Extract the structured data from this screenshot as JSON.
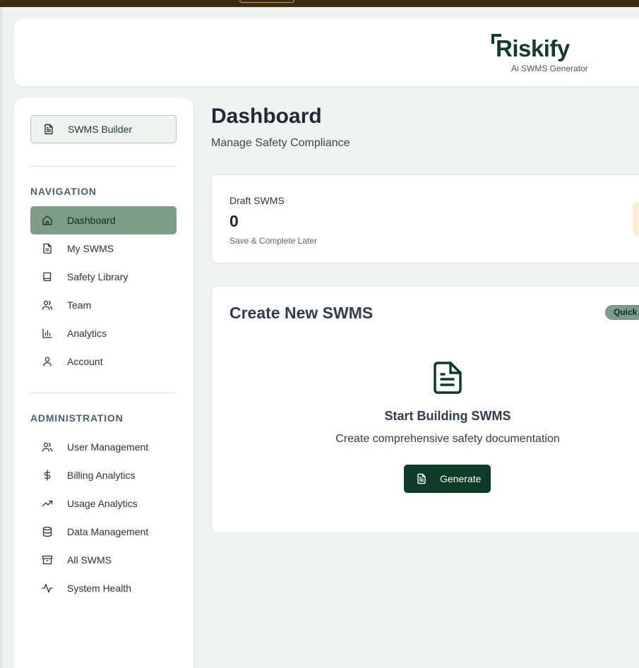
{
  "header": {
    "logo_word": "Riskify",
    "logo_sub": "Ai SWMS Generator"
  },
  "sidebar": {
    "builder_label": "SWMS Builder",
    "navigation_title": "NAVIGATION",
    "navigation": [
      {
        "label": "Dashboard",
        "icon": "home-icon",
        "active": true
      },
      {
        "label": "My SWMS",
        "icon": "file-icon"
      },
      {
        "label": "Safety Library",
        "icon": "book-icon"
      },
      {
        "label": "Team",
        "icon": "users-icon"
      },
      {
        "label": "Analytics",
        "icon": "bar-chart-icon"
      },
      {
        "label": "Account",
        "icon": "user-icon"
      }
    ],
    "administration_title": "ADMINISTRATION",
    "administration": [
      {
        "label": "User Management",
        "icon": "users-icon"
      },
      {
        "label": "Billing Analytics",
        "icon": "dollar-icon"
      },
      {
        "label": "Usage Analytics",
        "icon": "trending-up-icon"
      },
      {
        "label": "Data Management",
        "icon": "database-icon"
      },
      {
        "label": "All SWMS",
        "icon": "archive-icon"
      },
      {
        "label": "System Health",
        "icon": "activity-icon"
      }
    ]
  },
  "main": {
    "title": "Dashboard",
    "subtitle": "Manage Safety Compliance",
    "stat": {
      "label": "Draft SWMS",
      "value": "0",
      "note": "Save & Complete Later"
    },
    "create": {
      "title": "Create New SWMS",
      "badge": "Quick",
      "start_title": "Start Building SWMS",
      "start_sub": "Create comprehensive safety documentation",
      "button_label": "Generate"
    }
  },
  "colors": {
    "brand_dark": "#0d3b27",
    "active_nav": "#7e9d89",
    "top_bar": "#3e2a10"
  }
}
